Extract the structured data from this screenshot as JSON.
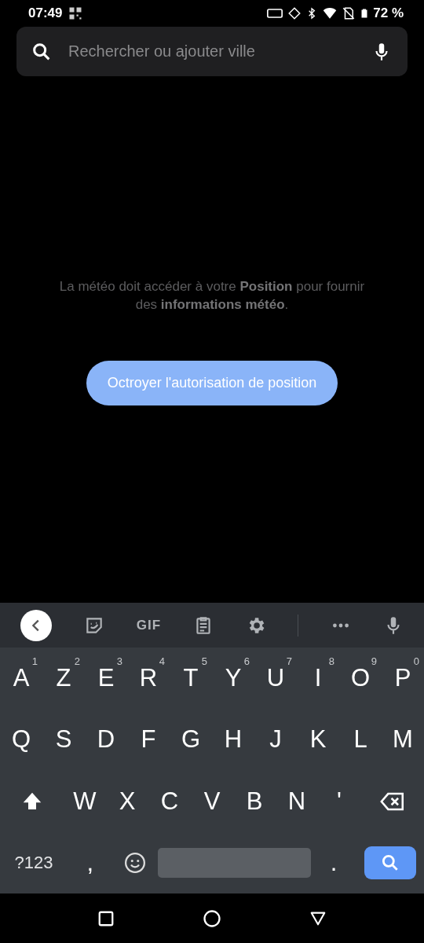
{
  "status_bar": {
    "time": "07:49",
    "battery": "72 %"
  },
  "search": {
    "placeholder": "Rechercher ou ajouter ville"
  },
  "message": "La météo doit accéder à votre **Position** pour fournir des **informations météo**.",
  "grant_button": {
    "label": "Octroyer l'autorisation de position"
  },
  "keyboard": {
    "toolbar": [
      {
        "kind": "back"
      },
      {
        "kind": "sticker"
      },
      {
        "kind": "text",
        "label": "GIF"
      },
      {
        "kind": "clipboard"
      },
      {
        "kind": "settings"
      },
      {
        "kind": "divider"
      },
      {
        "kind": "more"
      },
      {
        "kind": "mic"
      }
    ],
    "rows": [
      [
        {
          "kind": "letter",
          "label": "A",
          "hint": "1"
        },
        {
          "kind": "letter",
          "label": "Z",
          "hint": "2"
        },
        {
          "kind": "letter",
          "label": "E",
          "hint": "3"
        },
        {
          "kind": "letter",
          "label": "R",
          "hint": "4"
        },
        {
          "kind": "letter",
          "label": "T",
          "hint": "5"
        },
        {
          "kind": "letter",
          "label": "Y",
          "hint": "6"
        },
        {
          "kind": "letter",
          "label": "U",
          "hint": "7"
        },
        {
          "kind": "letter",
          "label": "I",
          "hint": "8"
        },
        {
          "kind": "letter",
          "label": "O",
          "hint": "9"
        },
        {
          "kind": "letter",
          "label": "P",
          "hint": "0"
        }
      ],
      [
        {
          "kind": "letter",
          "label": "Q"
        },
        {
          "kind": "letter",
          "label": "S"
        },
        {
          "kind": "letter",
          "label": "D"
        },
        {
          "kind": "letter",
          "label": "F"
        },
        {
          "kind": "letter",
          "label": "G"
        },
        {
          "kind": "letter",
          "label": "H"
        },
        {
          "kind": "letter",
          "label": "J"
        },
        {
          "kind": "letter",
          "label": "K"
        },
        {
          "kind": "letter",
          "label": "L"
        },
        {
          "kind": "letter",
          "label": "M"
        }
      ],
      [
        {
          "kind": "shift"
        },
        {
          "kind": "letter",
          "label": "W"
        },
        {
          "kind": "letter",
          "label": "X"
        },
        {
          "kind": "letter",
          "label": "C"
        },
        {
          "kind": "letter",
          "label": "V"
        },
        {
          "kind": "letter",
          "label": "B"
        },
        {
          "kind": "letter",
          "label": "N"
        },
        {
          "kind": "letter",
          "label": "'"
        },
        {
          "kind": "backspace"
        }
      ],
      [
        {
          "kind": "symbols",
          "label": "?123"
        },
        {
          "kind": "letter",
          "label": ","
        },
        {
          "kind": "emoji"
        },
        {
          "kind": "space"
        },
        {
          "kind": "letter",
          "label": "."
        },
        {
          "kind": "search"
        }
      ]
    ]
  }
}
